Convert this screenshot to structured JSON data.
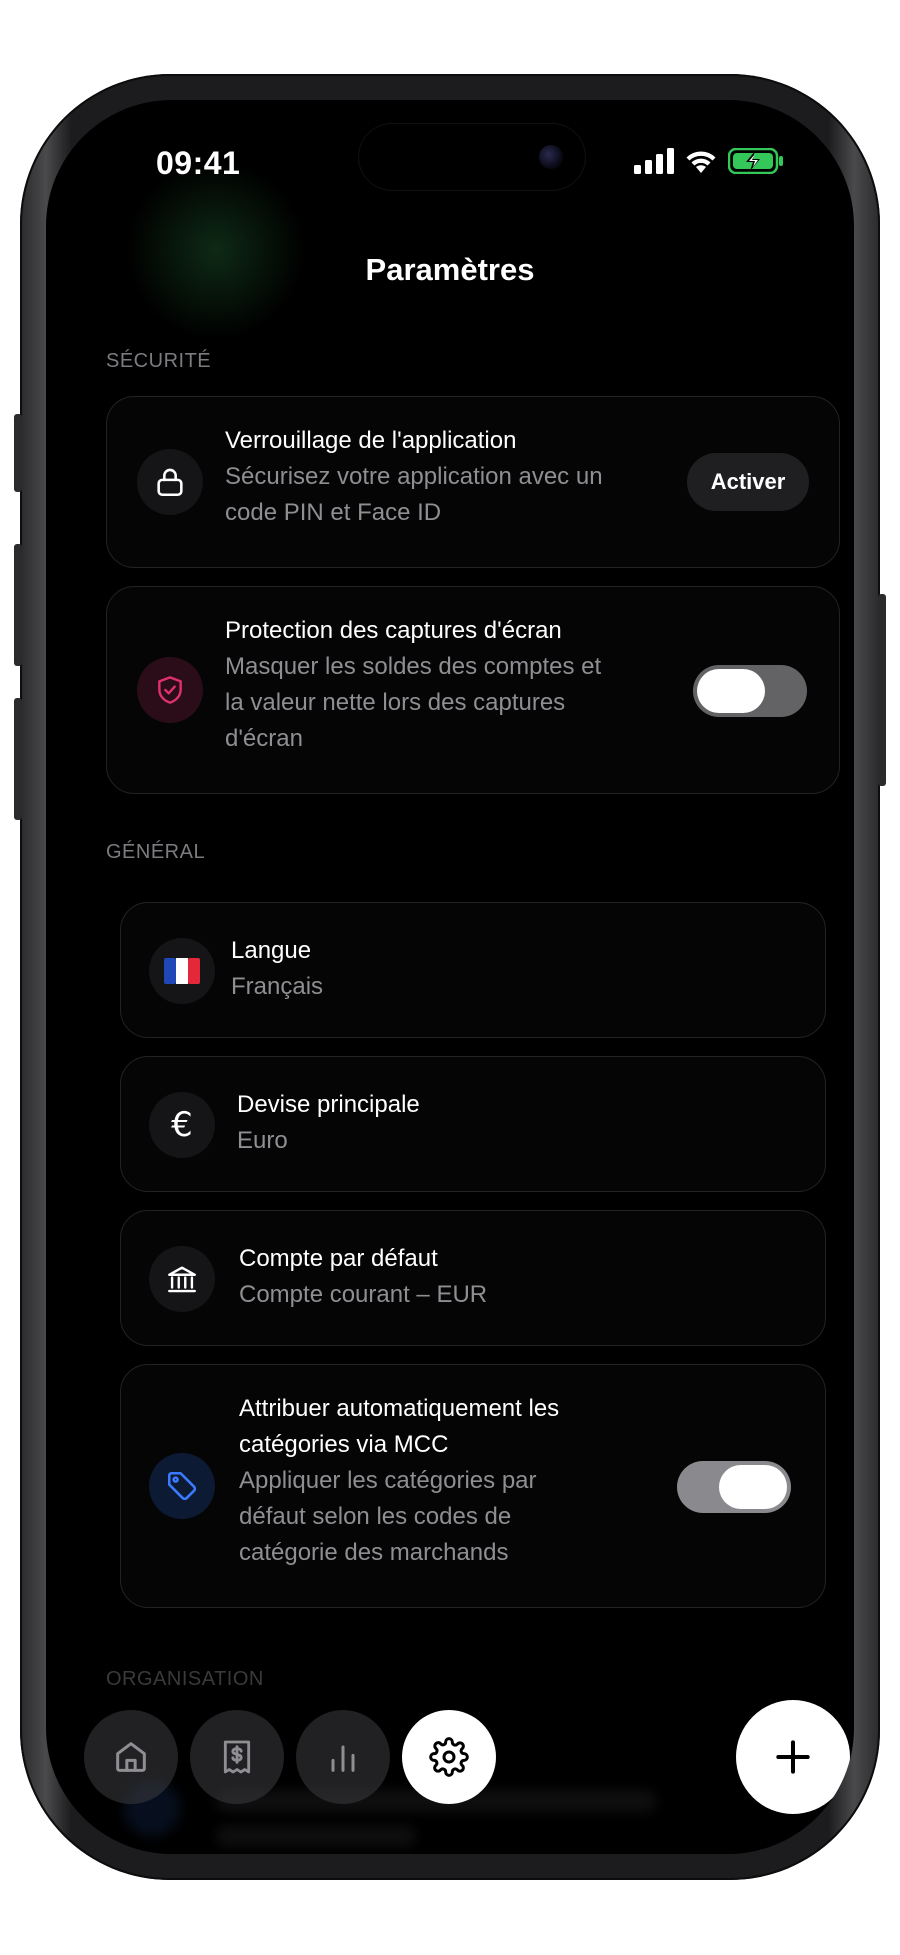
{
  "status_bar": {
    "time": "09:41"
  },
  "header": {
    "title": "Paramètres"
  },
  "sections": {
    "security": {
      "label": "SÉCURITÉ",
      "app_lock": {
        "title": "Verrouillage de l'application",
        "subtitle_line1": "Sécurisez votre application avec un",
        "subtitle_line2": "code PIN et Face ID",
        "button_label": "Activer",
        "icon": "lock-icon"
      },
      "screenshot_protection": {
        "title": "Protection des captures d'écran",
        "subtitle_line1": "Masquer les soldes des comptes et",
        "subtitle_line2": "la valeur nette lors des captures",
        "subtitle_line3": "d'écran",
        "icon": "shield-check-icon",
        "icon_color": "#e0306e",
        "toggle_on": false
      }
    },
    "general": {
      "label": "GÉNÉRAL",
      "language": {
        "title": "Langue",
        "value": "Français",
        "icon": "french-flag-icon"
      },
      "currency": {
        "title": "Devise principale",
        "value": "Euro",
        "icon": "euro-icon"
      },
      "default_account": {
        "title": "Compte par défaut",
        "value": "Compte courant – EUR",
        "icon": "bank-icon"
      },
      "mcc": {
        "title_line1": "Attribuer automatiquement les",
        "title_line2": "catégories via MCC",
        "subtitle_line1": "Appliquer les catégories par",
        "subtitle_line2": "défaut selon les codes de",
        "subtitle_line3": "catégorie des marchands",
        "icon": "tag-icon",
        "icon_color": "#3b7bff",
        "toggle_on": true
      }
    },
    "organisation": {
      "label": "ORGANISATION"
    }
  },
  "tab_bar": {
    "items": [
      {
        "icon": "home-icon",
        "active": false
      },
      {
        "icon": "receipt-icon",
        "active": false
      },
      {
        "icon": "chart-icon",
        "active": false
      },
      {
        "icon": "gear-icon",
        "active": true
      }
    ],
    "fab_icon": "plus-icon"
  },
  "colors": {
    "background": "#000000",
    "card_border": "#232326",
    "secondary_text": "#8e8e93",
    "toggle_track": "#636366",
    "battery": "#34c759"
  }
}
